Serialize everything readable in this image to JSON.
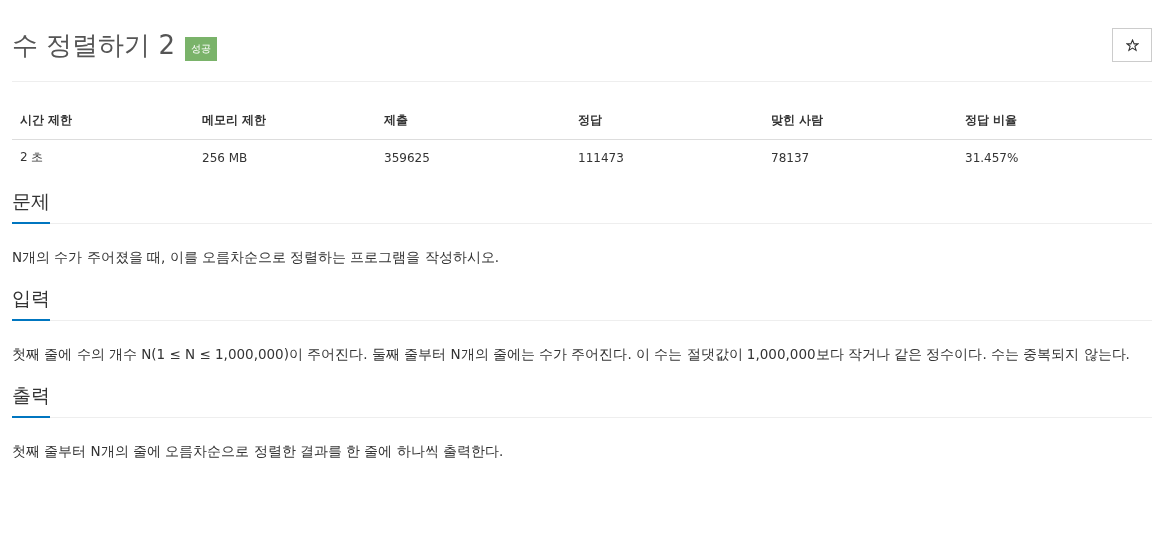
{
  "problem": {
    "title": "수 정렬하기 2",
    "badge": "성공"
  },
  "info_table": {
    "columns": [
      "시간 제한",
      "메모리 제한",
      "제출",
      "정답",
      "맞힌 사람",
      "정답 비율"
    ],
    "rows": [
      [
        "2 초",
        "256 MB",
        "359625",
        "111473",
        "78137",
        "31.457%"
      ]
    ]
  },
  "sections": [
    {
      "heading": "문제",
      "text": "N개의 수가 주어졌을 때, 이를 오름차순으로 정렬하는 프로그램을 작성하시오."
    },
    {
      "heading": "입력",
      "text": "첫째 줄에 수의 개수 N(1 ≤ N ≤ 1,000,000)이 주어진다. 둘째 줄부터 N개의 줄에는 수가 주어진다. 이 수는 절댓값이 1,000,000보다 작거나 같은 정수이다. 수는 중복되지 않는다."
    },
    {
      "heading": "출력",
      "text": "첫째 줄부터 N개의 줄에 오름차순으로 정렬한 결과를 한 줄에 하나씩 출력한다."
    }
  ]
}
